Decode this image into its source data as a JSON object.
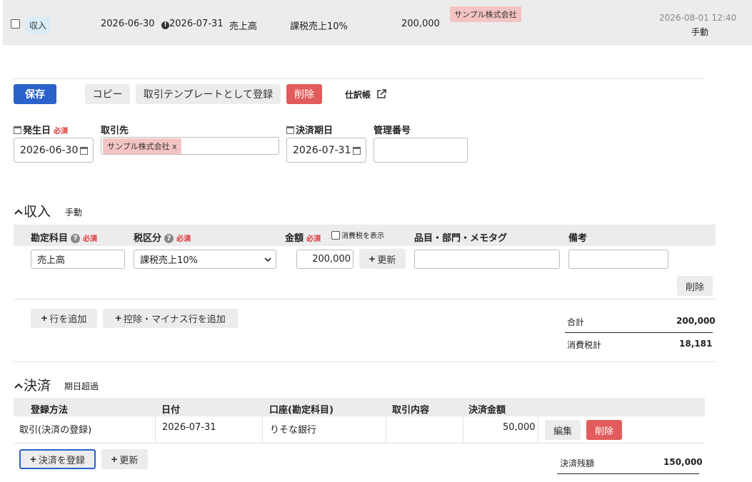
{
  "top_row": {
    "type_tag": "収入",
    "issue_date": "2026-06-30",
    "due_date": "2026-07-31",
    "account": "売上高",
    "tax": "課税売上10%",
    "amount": "200,000",
    "partner_tag": "サンプル株式会社",
    "timestamp": "2026-08-01 12:40",
    "mode": "手動"
  },
  "toolbar": {
    "save": "保存",
    "copy": "コピー",
    "template": "取引テンプレートとして登録",
    "delete": "削除",
    "journal": "仕訳帳"
  },
  "form": {
    "issue_date_label": "発生日",
    "required": "必須",
    "issue_date_value": "2026-06-30",
    "partner_label": "取引先",
    "partner_chip": "サンプル株式会社",
    "partner_chip_remove": "x",
    "due_date_label": "決済期日",
    "due_date_value": "2026-07-31",
    "mgmt_no_label": "管理番号",
    "mgmt_no_value": ""
  },
  "income": {
    "title": "収入",
    "mode": "手動",
    "headers": {
      "account": "勘定科目",
      "tax": "税区分",
      "amount": "金額",
      "show_tax": "消費税を表示",
      "item": "品目・部門・メモタグ",
      "note": "備考"
    },
    "row": {
      "account": "売上高",
      "tax": "課税売上10%",
      "amount": "200,000",
      "update": "更新",
      "item": "",
      "note": "",
      "delete": "削除"
    },
    "add_row": "行を追加",
    "add_deduction": "控除・マイナス行を追加",
    "total_label": "合計",
    "total_value": "200,000",
    "tax_label": "消費税計",
    "tax_value": "18,181"
  },
  "settlement": {
    "title": "決済",
    "status": "期日超過",
    "headers": {
      "method": "登録方法",
      "date": "日付",
      "account": "口座(勘定科目)",
      "content": "取引内容",
      "amount": "決済金額"
    },
    "row": {
      "method": "取引(決済の登録)",
      "date": "2026-07-31",
      "account": "りそな銀行",
      "content": "",
      "amount": "50,000",
      "edit": "編集",
      "delete": "削除"
    },
    "register": "決済を登録",
    "update": "更新",
    "balance_label": "決済残額",
    "balance_value": "150,000"
  }
}
